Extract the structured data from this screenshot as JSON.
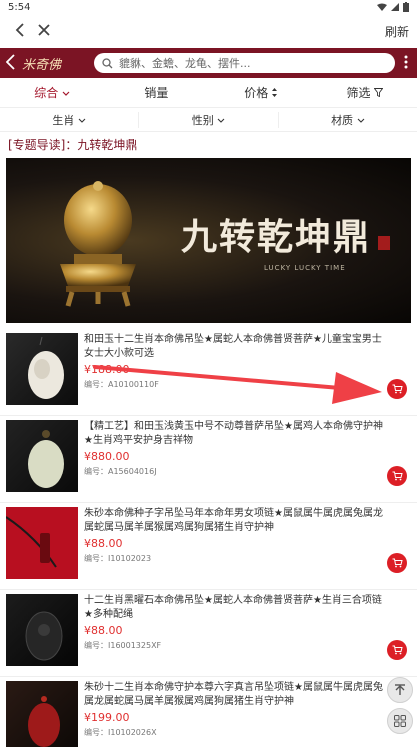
{
  "status": {
    "time": "5:54"
  },
  "browser": {
    "refresh": "刷新"
  },
  "header": {
    "logo": "米奇佛",
    "search_placeholder": "貔貅、金蟾、龙龟、摆件..."
  },
  "sort": [
    "综合",
    "销量",
    "价格",
    "筛选"
  ],
  "filters": [
    "生肖",
    "性别",
    "材质"
  ],
  "topic": "[专题导读]：九转乾坤鼎",
  "banner": {
    "title": "九转乾坤鼎",
    "subtitle": "LUCKY LUCKY TIME"
  },
  "products": [
    {
      "title": "和田玉十二生肖本命佛吊坠★属蛇人本命佛普贤菩萨★儿童宝宝男士女士大小款可选",
      "price": "¥188.00",
      "code": "编号：A10100110F"
    },
    {
      "title": "【精工艺】和田玉浅黄玉中号不动尊普萨吊坠★属鸡人本命佛守护神★生肖鸡平安护身吉祥物",
      "price": "¥880.00",
      "code": "编号：A15604016J"
    },
    {
      "title": "朱砂本命佛种子字吊坠马年本命年男女项链★属鼠属牛属虎属兔属龙属蛇属马属羊属猴属鸡属狗属猪生肖守护神",
      "price": "¥88.00",
      "code": "编号：I10102023"
    },
    {
      "title": "十二生肖黑曜石本命佛吊坠★属蛇人本命佛普贤菩萨★生肖三合项链★多种配绳",
      "price": "¥88.00",
      "code": "编号：I16001325XF"
    },
    {
      "title": "朱砂十二生肖本命佛守护本尊六字真言吊坠项链★属鼠属牛属虎属兔属龙属蛇属马属羊属猴属鸡属狗属猪生肖守护神",
      "price": "¥199.00",
      "code": "编号：I10102026X"
    }
  ],
  "colors": {
    "brand": "#7b1424",
    "price": "#e03030",
    "cart": "#dc1f26"
  }
}
